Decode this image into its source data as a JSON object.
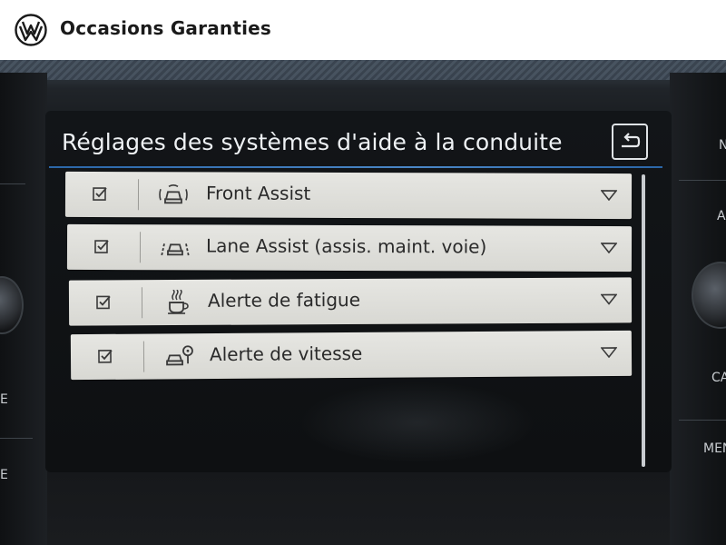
{
  "header": {
    "brand": "Occasions Garanties",
    "logo_icon": "vw-logo-icon"
  },
  "screen": {
    "title": "Réglages des systèmes d'aide à la conduite",
    "back_icon": "back-arrow-icon",
    "items": [
      {
        "label": "Front Assist",
        "checked": true,
        "icon": "front-assist-car-icon"
      },
      {
        "label": "Lane Assist (assis. maint. voie)",
        "checked": true,
        "icon": "lane-assist-car-icon"
      },
      {
        "label": "Alerte de fatigue",
        "checked": true,
        "icon": "coffee-cup-icon"
      },
      {
        "label": "Alerte de vitesse",
        "checked": true,
        "icon": "speed-warning-car-icon"
      }
    ]
  },
  "bezel": {
    "left": [
      "E",
      "E"
    ],
    "right": [
      "N",
      "A",
      "CA",
      "MEN"
    ]
  },
  "colors": {
    "accent": "#3f7bbd",
    "row_bg": "#dededa",
    "text_dark": "#2a2a2a",
    "screen_bg": "#111315"
  }
}
